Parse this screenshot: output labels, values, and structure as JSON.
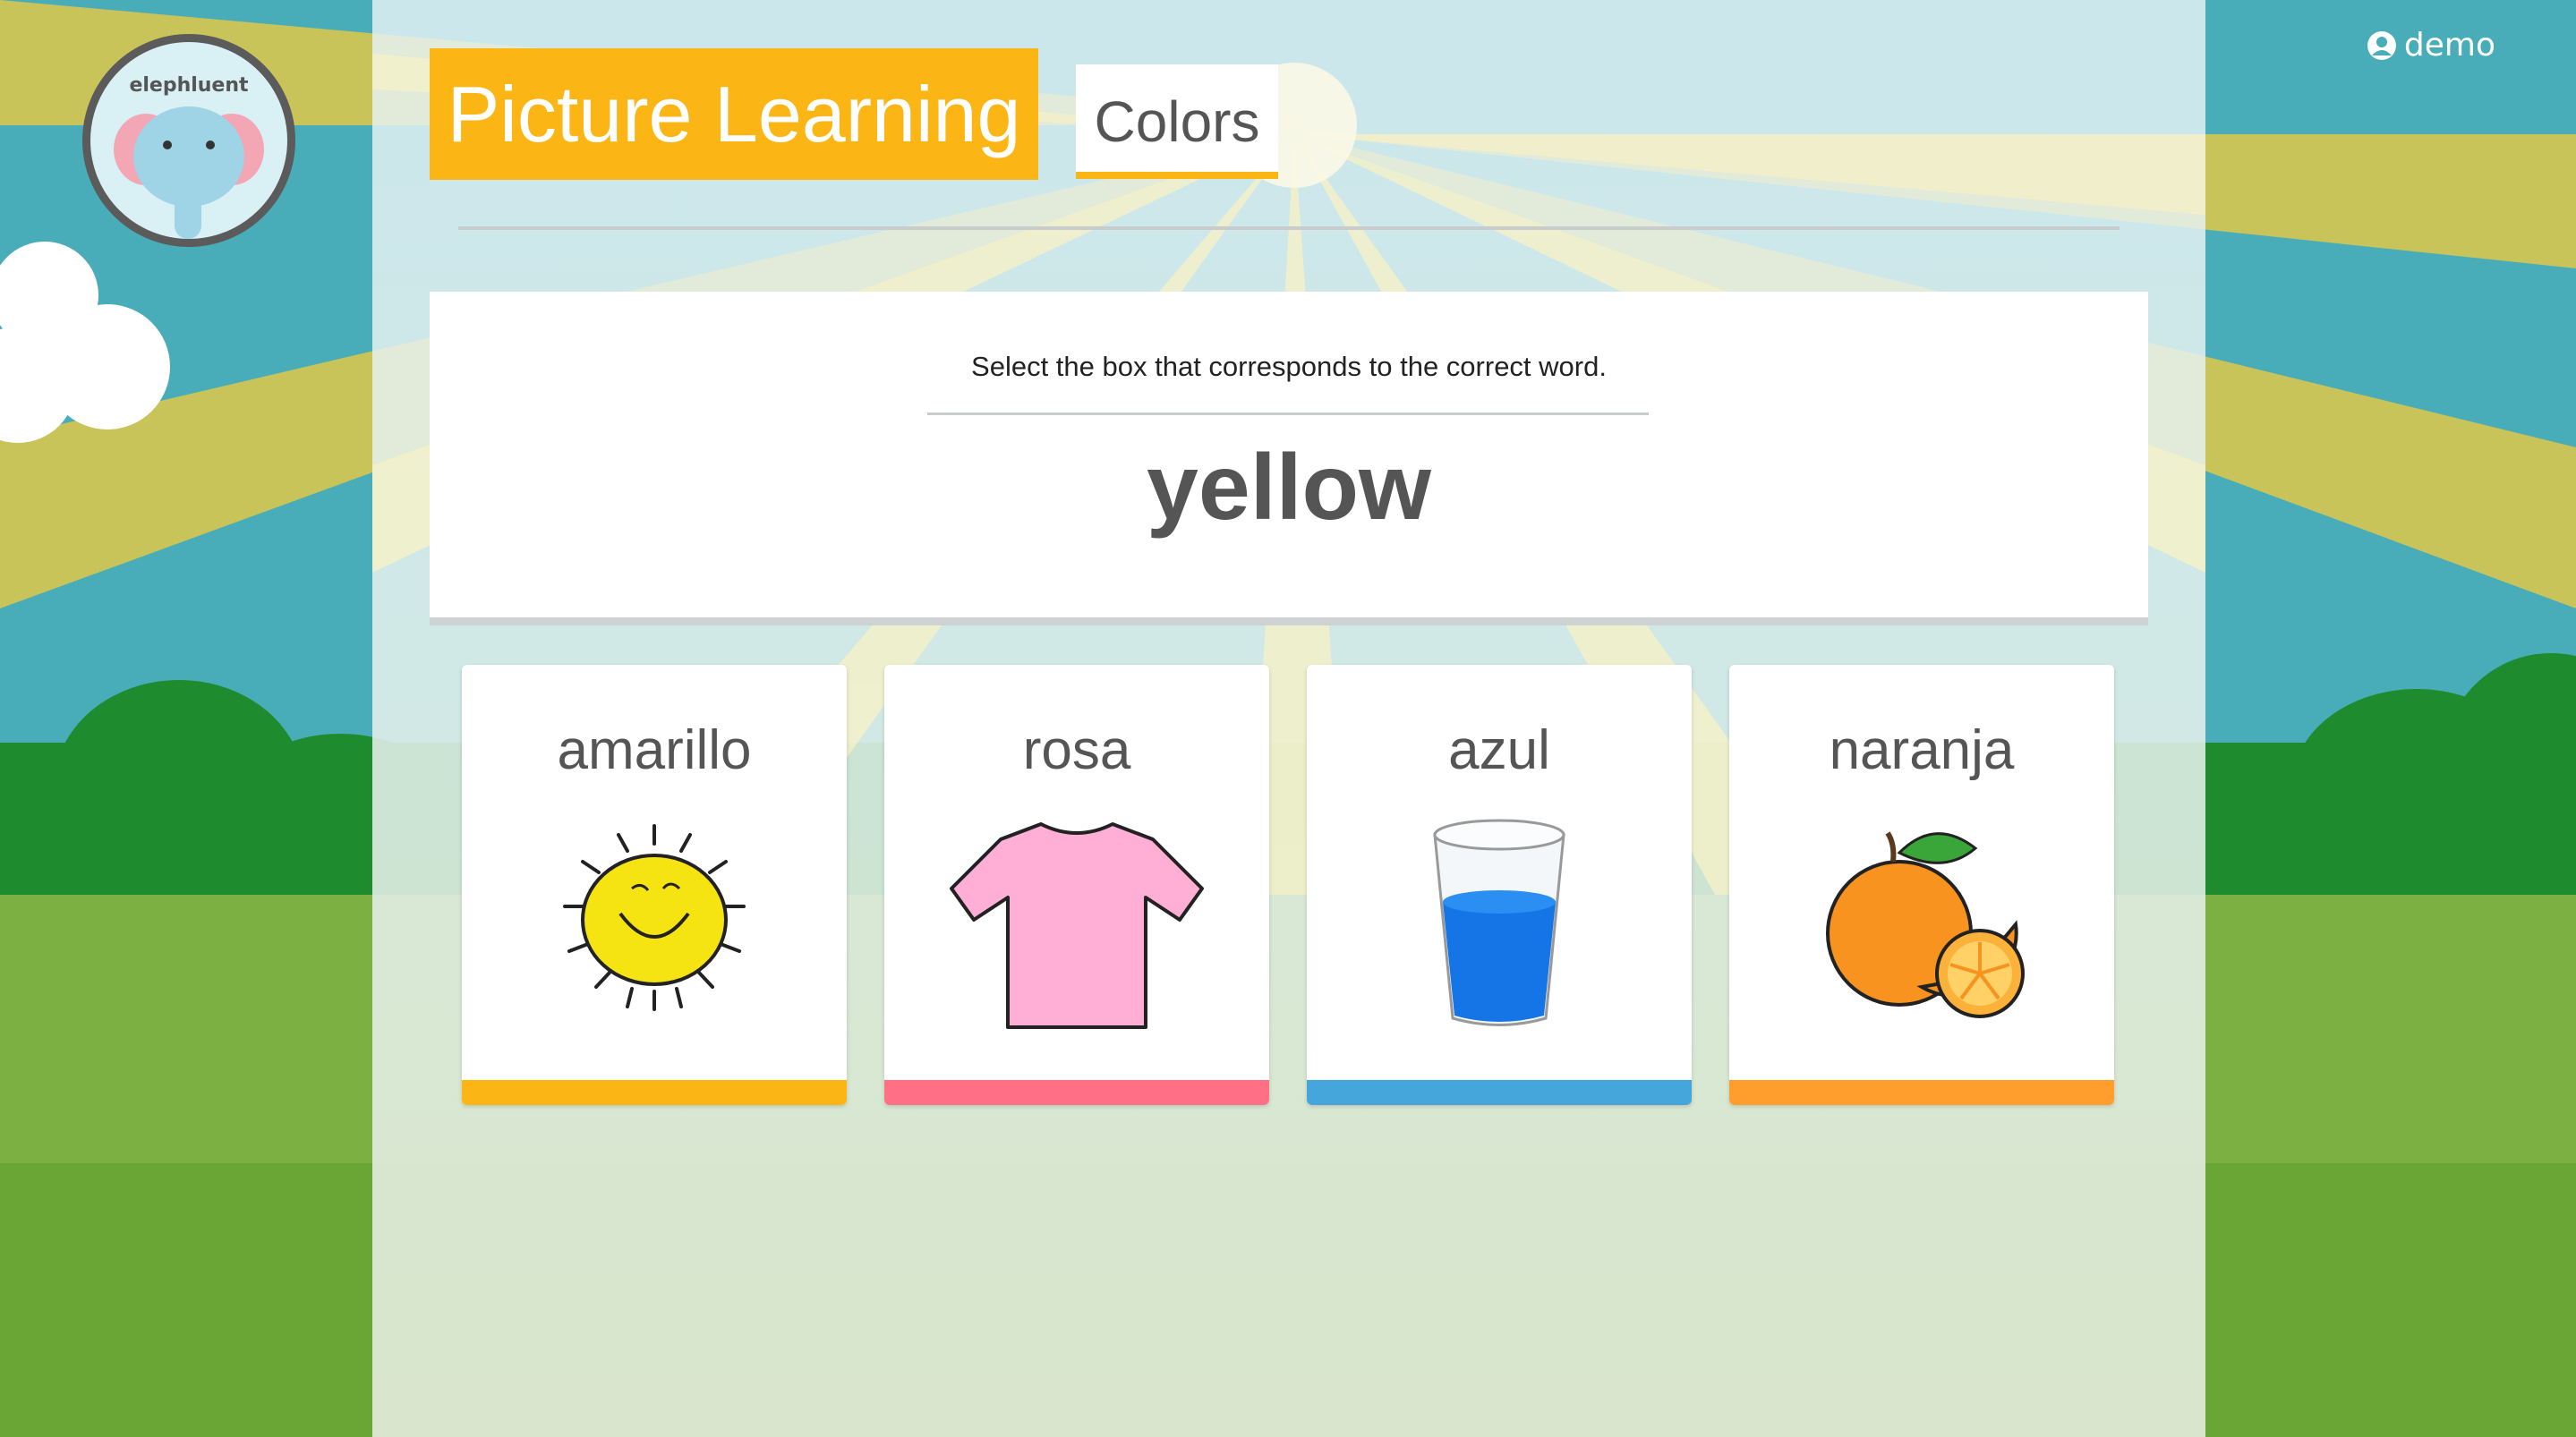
{
  "app": {
    "logo_text": "elephluent",
    "user_name": "demo"
  },
  "header": {
    "title": "Picture Learning",
    "topic": "Colors"
  },
  "question": {
    "instruction": "Select the box that corresponds to the correct word.",
    "word": "yellow"
  },
  "choices": [
    {
      "label": "amarillo",
      "image": "sun-icon",
      "color": "#fbb616"
    },
    {
      "label": "rosa",
      "image": "pink-shirt-icon",
      "color": "#ff6f85"
    },
    {
      "label": "azul",
      "image": "blue-water-glass-icon",
      "color": "#45a6dc"
    },
    {
      "label": "naranja",
      "image": "orange-fruit-icon",
      "color": "#ff9e2c"
    }
  ],
  "colors": {
    "accent": "#fbb616",
    "text": "#555555"
  }
}
